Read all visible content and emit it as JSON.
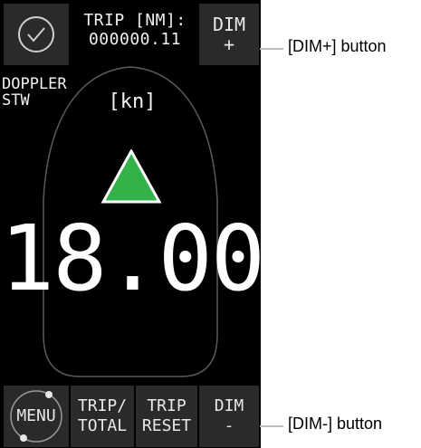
{
  "header": {
    "trip_label": "TRIP [NM]:",
    "trip_value": "000000.11",
    "dim_plus_label": "DIM",
    "dim_plus_sign": "+"
  },
  "display": {
    "mode_line1": "DOPPLER",
    "mode_line2": "STW",
    "unit": "[kn]",
    "speed": "18.00",
    "direction_icon": "up-triangle-icon",
    "arrow_color": "#33b24a"
  },
  "footer": {
    "menu_label": "MENU",
    "trip_total_line1": "TRIP/",
    "trip_total_line2": "TOTAL",
    "trip_reset_line1": "TRIP",
    "trip_reset_line2": "RESET",
    "dim_minus_label": "DIM",
    "dim_minus_sign": "-"
  },
  "annotations": {
    "dim_plus": "[DIM+] button",
    "dim_minus": "[DIM-] button"
  }
}
